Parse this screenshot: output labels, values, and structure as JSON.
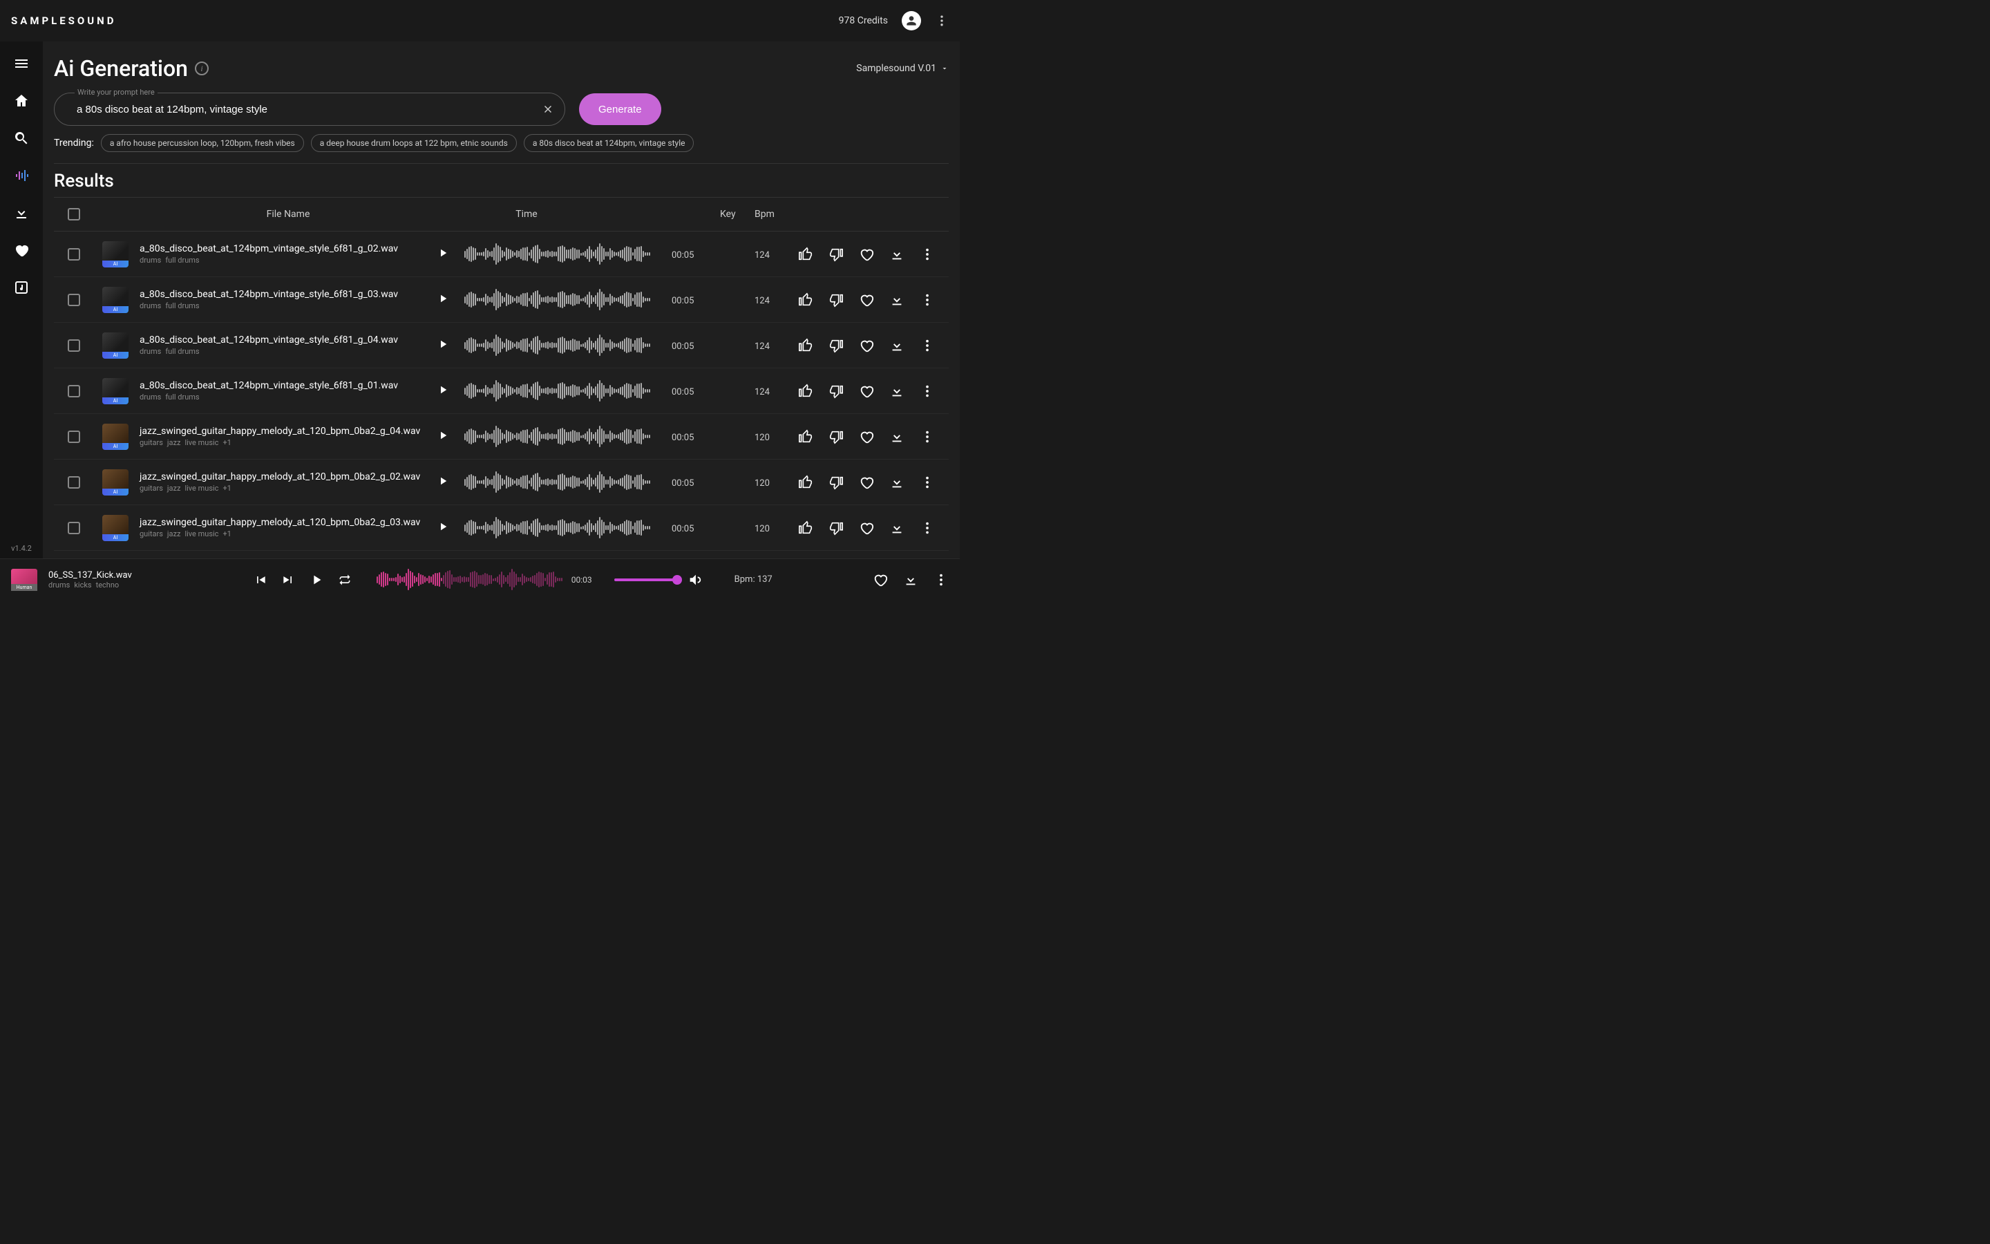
{
  "brand": "SAMPLESOUND",
  "credits": "978 Credits",
  "version": "v1.4.2",
  "page": {
    "title": "Ai Generation",
    "model": "Samplesound V.01",
    "prompt_label": "Write your prompt here",
    "prompt_value": "a 80s disco beat at 124bpm, vintage style",
    "generate_label": "Generate",
    "trending_label": "Trending:",
    "trending": [
      "a afro house percussion loop, 120bpm, fresh vibes",
      "a deep house drum loops at 122 bpm, etnic sounds",
      "a 80s disco beat at 124bpm, vintage style"
    ],
    "results_title": "Results"
  },
  "columns": {
    "file_name": "File Name",
    "time": "Time",
    "key": "Key",
    "bpm": "Bpm"
  },
  "rows": [
    {
      "name": "a_80s_disco_beat_at_124bpm_vintage_style_6f81_g_02.wav",
      "tags": [
        "drums",
        "full drums"
      ],
      "time": "00:05",
      "key": "",
      "bpm": "124",
      "style": "disco"
    },
    {
      "name": "a_80s_disco_beat_at_124bpm_vintage_style_6f81_g_03.wav",
      "tags": [
        "drums",
        "full drums"
      ],
      "time": "00:05",
      "key": "",
      "bpm": "124",
      "style": "disco"
    },
    {
      "name": "a_80s_disco_beat_at_124bpm_vintage_style_6f81_g_04.wav",
      "tags": [
        "drums",
        "full drums"
      ],
      "time": "00:05",
      "key": "",
      "bpm": "124",
      "style": "disco"
    },
    {
      "name": "a_80s_disco_beat_at_124bpm_vintage_style_6f81_g_01.wav",
      "tags": [
        "drums",
        "full drums"
      ],
      "time": "00:05",
      "key": "",
      "bpm": "124",
      "style": "disco"
    },
    {
      "name": "jazz_swinged_guitar_happy_melody_at_120_bpm_0ba2_g_04.wav",
      "tags": [
        "guitars",
        "jazz",
        "live music",
        "+1"
      ],
      "time": "00:05",
      "key": "",
      "bpm": "120",
      "style": "jazz"
    },
    {
      "name": "jazz_swinged_guitar_happy_melody_at_120_bpm_0ba2_g_02.wav",
      "tags": [
        "guitars",
        "jazz",
        "live music",
        "+1"
      ],
      "time": "00:05",
      "key": "",
      "bpm": "120",
      "style": "jazz"
    },
    {
      "name": "jazz_swinged_guitar_happy_melody_at_120_bpm_0ba2_g_03.wav",
      "tags": [
        "guitars",
        "jazz",
        "live music",
        "+1"
      ],
      "time": "00:05",
      "key": "",
      "bpm": "120",
      "style": "jazz"
    }
  ],
  "player": {
    "thumb_tag": "Human",
    "name": "06_SS_137_Kick.wav",
    "tags": [
      "drums",
      "kicks",
      "techno"
    ],
    "time": "00:03",
    "bpm_label": "Bpm: 137",
    "volume": 0.92,
    "progress": 0.35,
    "accent": "#d03a8a"
  },
  "thumb_ai_label": "AI",
  "colors": {
    "accent": "#c766d6"
  }
}
